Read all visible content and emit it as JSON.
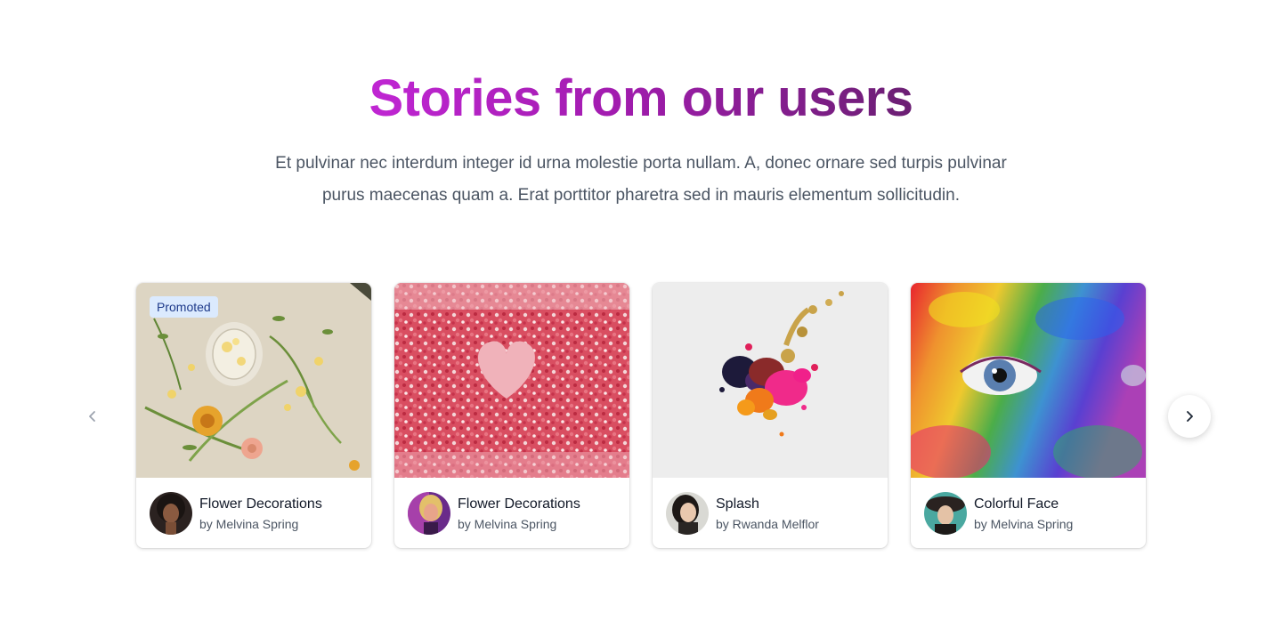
{
  "section": {
    "title": "Stories from our users",
    "subtitle_line1": "Et pulvinar nec interdum integer id urna molestie porta nullam. A, donec ornare sed turpis pulvinar",
    "subtitle_line2": "purus maecenas quam a. Erat porttitor pharetra sed in mauris elementum sollicitudin."
  },
  "carousel": {
    "prev_icon": "chevron-left-icon",
    "next_icon": "chevron-right-icon",
    "cards": [
      {
        "badge": "Promoted",
        "title": "Flower Decorations",
        "author": "by Melvina Spring",
        "image": "flowers-photo",
        "avatar": "woman-curly-hair-avatar"
      },
      {
        "badge": "",
        "title": "Flower Decorations",
        "author": "by Melvina Spring",
        "image": "sprinkles-heart-photo",
        "avatar": "woman-neon-avatar"
      },
      {
        "badge": "",
        "title": "Splash",
        "author": "by Rwanda Melflor",
        "image": "paint-splash-photo",
        "avatar": "woman-smiling-avatar"
      },
      {
        "badge": "",
        "title": "Colorful Face",
        "author": "by Melvina Spring",
        "image": "colorful-face-photo",
        "avatar": "woman-hat-avatar"
      }
    ]
  },
  "colors": {
    "title_gradient_start": "#c026d3",
    "title_gradient_end": "#6b1f73",
    "badge_bg": "#dbeafe",
    "badge_text": "#1e3a8a",
    "body_text": "#4b5563"
  }
}
